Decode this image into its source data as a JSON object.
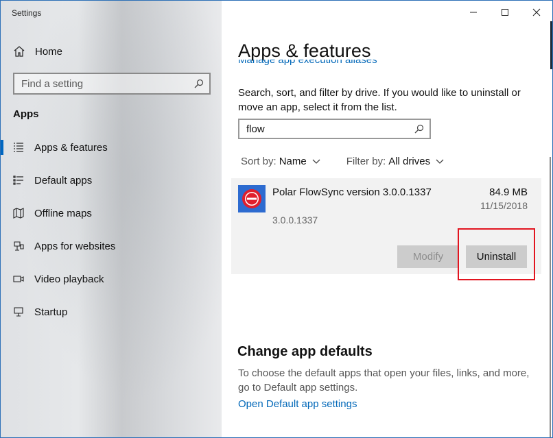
{
  "window": {
    "title": "Settings",
    "controls": {
      "minimize": "minimize-icon",
      "maximize": "maximize-icon",
      "close": "close-icon"
    }
  },
  "sidebar": {
    "home_label": "Home",
    "search_placeholder": "Find a setting",
    "section_heading": "Apps",
    "items": [
      {
        "label": "Apps & features",
        "icon": "apps-features-icon",
        "active": true
      },
      {
        "label": "Default apps",
        "icon": "default-apps-icon",
        "active": false
      },
      {
        "label": "Offline maps",
        "icon": "map-icon",
        "active": false
      },
      {
        "label": "Apps for websites",
        "icon": "apps-websites-icon",
        "active": false
      },
      {
        "label": "Video playback",
        "icon": "video-icon",
        "active": false
      },
      {
        "label": "Startup",
        "icon": "startup-icon",
        "active": false
      }
    ]
  },
  "main": {
    "title": "Apps & features",
    "partial_link": "Manage app execution aliases",
    "description": "Search, sort, and filter by drive. If you would like to uninstall or move an app, select it from the list.",
    "search_value": "flow",
    "sort_key": "Sort by:",
    "sort_value": "Name",
    "filter_key": "Filter by:",
    "filter_value": "All drives",
    "app": {
      "name": "Polar FlowSync version 3.0.0.1337",
      "size": "84.9 MB",
      "date": "11/15/2018",
      "version": "3.0.0.1337",
      "modify_label": "Modify",
      "uninstall_label": "Uninstall"
    },
    "defaults_heading": "Change app defaults",
    "defaults_description": "To choose the default apps that open your files, links, and more, go to Default app settings.",
    "defaults_link": "Open Default app settings"
  },
  "colors": {
    "accent": "#0067b8",
    "highlight": "#e2141f",
    "app_icon_bg": "#2d6bd0"
  }
}
